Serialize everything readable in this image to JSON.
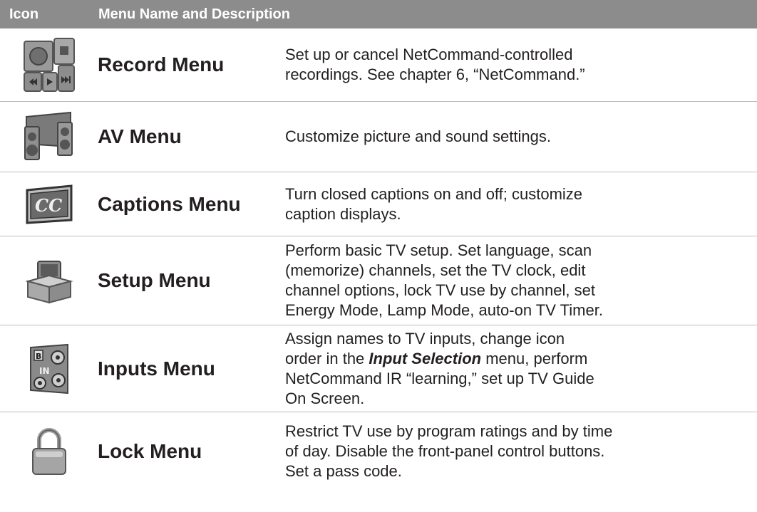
{
  "header": {
    "icon_col": "Icon",
    "desc_col": "Menu Name and Description"
  },
  "rows": [
    {
      "icon": "record-icon",
      "name": "Record Menu",
      "desc": [
        "Set up or cancel NetCommand-controlled",
        "recordings.  See chapter 6, “NetCommand.”"
      ]
    },
    {
      "icon": "av-speakers-icon",
      "name": "AV Menu",
      "desc": [
        "Customize picture and sound settings."
      ]
    },
    {
      "icon": "cc-icon",
      "name": "Captions Menu",
      "desc": [
        "Turn closed captions on and off; customize",
        "caption displays."
      ]
    },
    {
      "icon": "setup-box-icon",
      "name": "Setup Menu",
      "desc": [
        "Perform basic TV setup.  Set language, scan",
        "(memorize) channels, set the TV clock, edit",
        "channel options, lock TV use by channel, set",
        "Energy Mode, Lamp Mode, auto-on TV Timer."
      ]
    },
    {
      "icon": "inputs-jacks-icon",
      "name": "Inputs Menu",
      "desc": [
        "Assign names to TV inputs, change icon",
        "order in the",
        "Input Selection",
        "menu, perform",
        "NetCommand IR “learning,” set up TV Guide",
        "On Screen."
      ]
    },
    {
      "icon": "padlock-icon",
      "name": "Lock Menu",
      "desc": [
        "Restrict TV use by program ratings and by time",
        "of day.  Disable the front-panel control buttons.",
        "Set a pass code."
      ]
    }
  ]
}
